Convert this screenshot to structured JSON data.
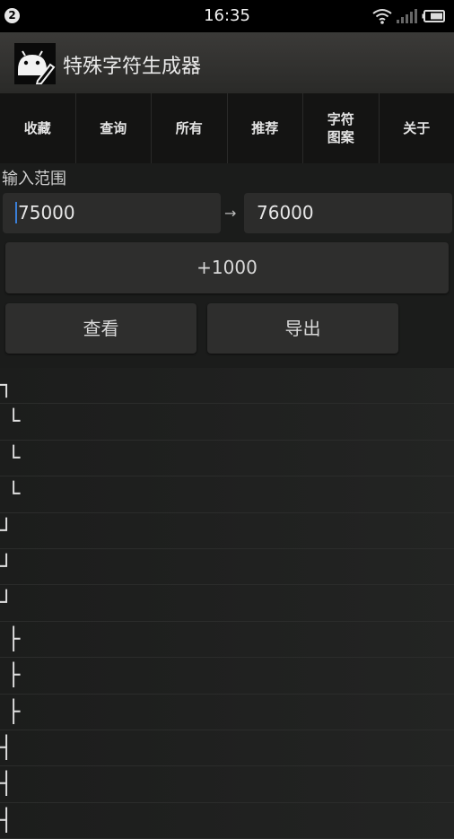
{
  "status_bar": {
    "notification_count": "2",
    "time": "16:35",
    "icons": [
      "wifi-icon",
      "signal-icon",
      "battery-icon"
    ]
  },
  "app": {
    "title": "特殊字符生成器",
    "icon": "android-edit-icon"
  },
  "tabs": [
    {
      "label": "收藏"
    },
    {
      "label": "查询"
    },
    {
      "label": "所有"
    },
    {
      "label": "推荐"
    },
    {
      "label": "字符\n图案"
    },
    {
      "label": "关于"
    }
  ],
  "range": {
    "label": "输入范围",
    "start_value": "75000",
    "separator": "→",
    "end_value": "76000"
  },
  "buttons": {
    "increment_label": "+1000",
    "view_label": "查看",
    "export_label": "导出"
  },
  "characters": [
    {
      "char": "┐",
      "indent": 0
    },
    {
      "char": "└",
      "indent": 1
    },
    {
      "char": "└",
      "indent": 1
    },
    {
      "char": "└",
      "indent": 1
    },
    {
      "char": "┘",
      "indent": 0
    },
    {
      "char": "┘",
      "indent": 0
    },
    {
      "char": "┘",
      "indent": 0
    },
    {
      "char": "├",
      "indent": 1
    },
    {
      "char": "├",
      "indent": 1
    },
    {
      "char": "├",
      "indent": 1
    },
    {
      "char": "┤",
      "indent": 0
    },
    {
      "char": "┤",
      "indent": 0
    },
    {
      "char": "┤",
      "indent": 0
    }
  ],
  "colors": {
    "background": "#1b1c1b",
    "actionbar": "#32312f",
    "tabbar": "#141413",
    "accent_caret": "#3a7fd8"
  }
}
